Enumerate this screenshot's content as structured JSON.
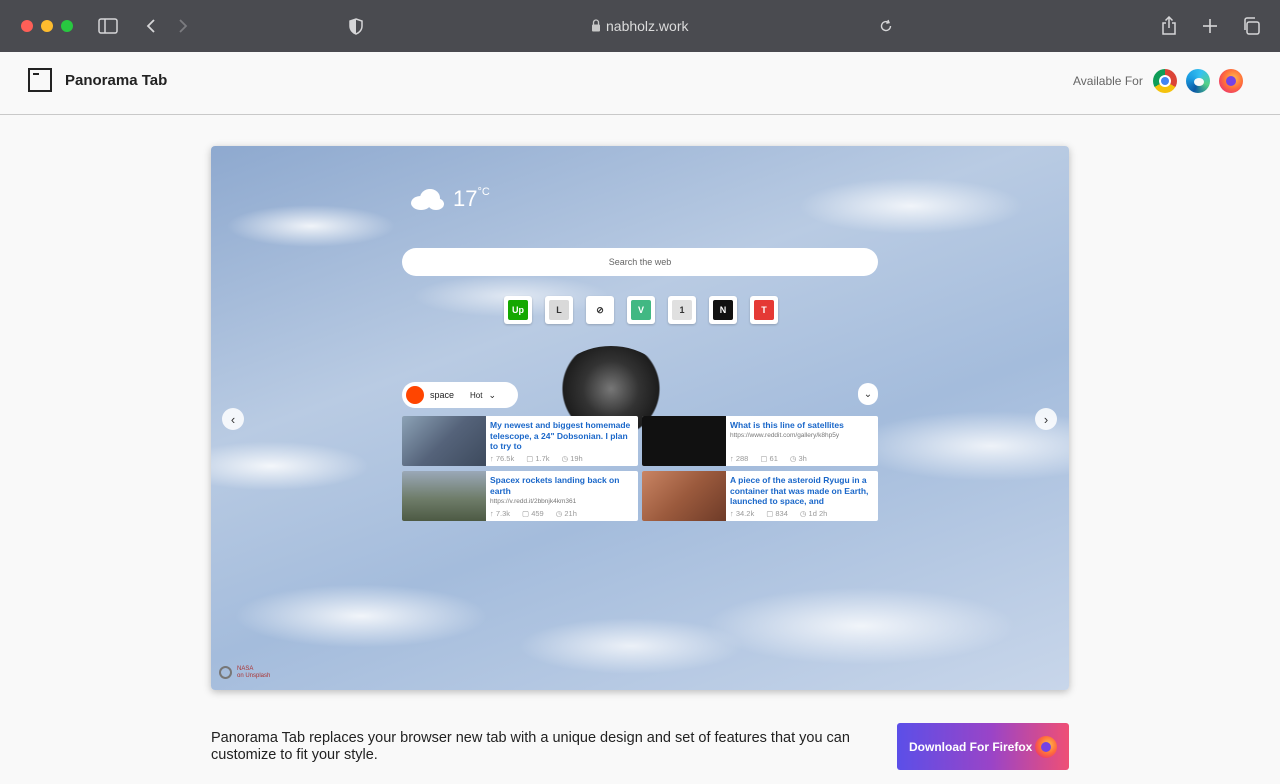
{
  "browser": {
    "url": "nabholz.work"
  },
  "header": {
    "brand": "Panorama Tab",
    "available_for": "Available For",
    "browsers": [
      "chrome-icon",
      "edge-icon",
      "firefox-icon"
    ]
  },
  "preview": {
    "temperature": "17",
    "temp_unit": "°C",
    "search_placeholder": "Search the web",
    "shortcuts": [
      {
        "name": "upwork",
        "label": "Up",
        "color": "#14a800"
      },
      {
        "name": "letter-l",
        "label": "L",
        "color": "#d9d9d9"
      },
      {
        "name": "safari",
        "label": "⊘",
        "color": "#ffffff"
      },
      {
        "name": "vue",
        "label": "V",
        "color": "#41b883"
      },
      {
        "name": "placeholder",
        "label": "1",
        "color": "#e0e0e0"
      },
      {
        "name": "notion",
        "label": "N",
        "color": "#111111"
      },
      {
        "name": "t-app",
        "label": "T",
        "color": "#e53935"
      }
    ],
    "subreddit": "space",
    "sort": "Hot",
    "posts": [
      {
        "title": "My newest and biggest homemade telescope, a 24\" Dobsonian. I plan to try to",
        "url": "",
        "upvotes": "76.5k",
        "comments": "1.7k",
        "age": "19h"
      },
      {
        "title": "What is this line of satellites",
        "url": "https://www.reddit.com/gallery/k8hp5y",
        "upvotes": "288",
        "comments": "61",
        "age": "3h"
      },
      {
        "title": "Spacex rockets landing back on earth",
        "url": "https://v.redd.it/2bbnjk4km361",
        "upvotes": "7.3k",
        "comments": "459",
        "age": "21h"
      },
      {
        "title": "A piece of the asteroid Ryugu in a container that was made on Earth, launched to space, and",
        "url": "",
        "upvotes": "34.2k",
        "comments": "834",
        "age": "1d 2h"
      }
    ],
    "credit_line1": "NASA",
    "credit_line2": "on Unsplash"
  },
  "footer": {
    "description": "Panorama Tab replaces your browser new tab with a unique design and set of features that you can customize to fit your style.",
    "download_label": "Download For Firefox"
  }
}
